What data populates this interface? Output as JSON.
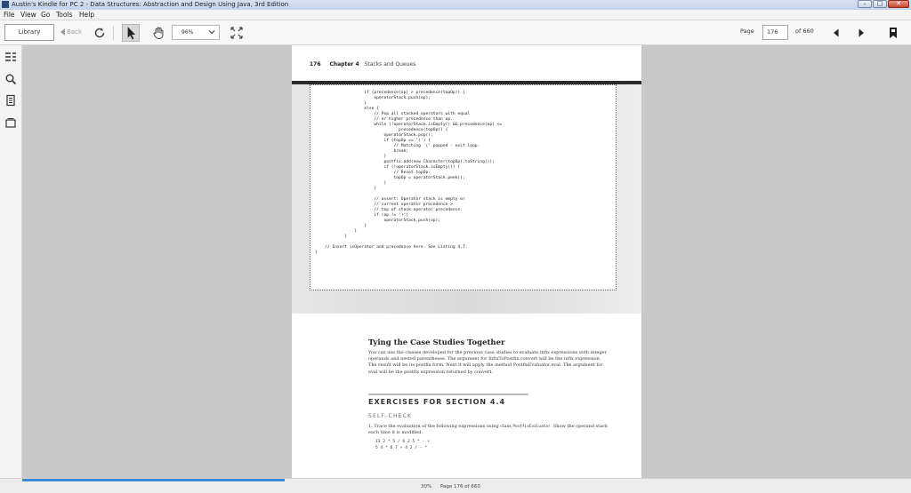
{
  "window": {
    "title": "Austin's Kindle for PC 2 - Data Structures: Abstraction and Design Using Java, 3rd Edition"
  },
  "menu": [
    "File",
    "View",
    "Go",
    "Tools",
    "Help"
  ],
  "toolbar": {
    "library_label": "Library",
    "back_label": "Back",
    "zoom_value": "96%",
    "page_label": "Page",
    "page_value": "176",
    "page_total": "of 660"
  },
  "page": {
    "number": "176",
    "chapter": "Chapter 4",
    "chapter_title": "Stacks and Queues",
    "code": "                    if (precedence(op) > precedence(topOp)) {\n                        operatorStack.push(op);\n                    }\n                    else {\n                        // Pop all stacked operators with equal\n                        // or higher precedence than op.\n                        while (!operatorStack.isEmpty() && precedence(op) <=\n                                  precedence(topOp)) {\n                            operatorStack.pop();\n                            if (topOp == '(') {\n                                // Matching '(' popped - exit loop.\n                                break;\n                            }\n                            postfix.add(new Character(topOp).toString());\n                            if (!operatorStack.isEmpty()) {\n                                // Reset topOp.\n                                topOp = operatorStack.peek();\n                            }\n                        }\n\n                        // assert: Operator stack is empty or\n                        // current operator precedence >\n                        // top of stack operator precedence.\n                        if (op != ')')\n                            operatorStack.push(op);\n                    }\n                }\n            }\n\n    // Insert isOperator and precedence here. See Listing 4.7.\n}",
    "section_title": "Tying the Case Studies Together",
    "paragraph": "You can use the classes developed for the previous case studies to evaluate infix expressions with integer operands and nested parentheses. The argument for InfixToPostfix.convert will be the infix expression. The result will be its postfix form. Next it will apply the method PostfixEvaluator.eval. The argument for eval will be the postfix expression returned by convert.",
    "exercises_title": "EXERCISES FOR SECTION 4.4",
    "self_check": "SELF-CHECK",
    "q1_num": "1.",
    "q1_text_a": "Trace the evaluation of the following expressions using class ",
    "q1_class": "PostfixEvaluator",
    "q1_text_b": ". Show the operand stack each time it is modified.",
    "expr1": "13 2 * 5 / 6 2 5 * - +",
    "expr2": "5 4 * 6 7 + 4 2 / - *"
  },
  "status": {
    "progress_text": "30%",
    "progress": 0.3,
    "page_status": "Page 176 of 660"
  },
  "colors": {
    "accent": "#3b8ad6",
    "close": "#c8452d"
  }
}
